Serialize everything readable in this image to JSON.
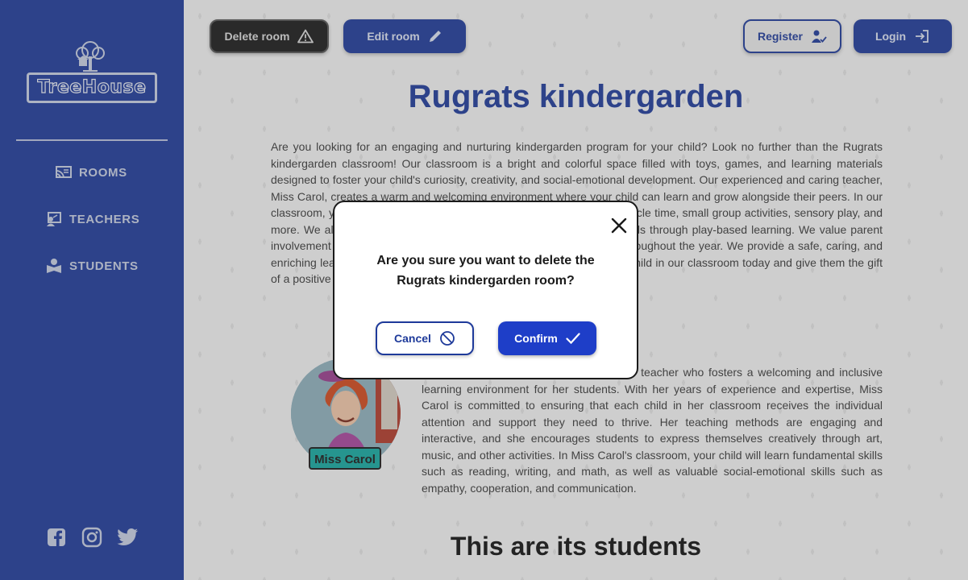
{
  "brand": {
    "name": "TreeHouse"
  },
  "sidebar": {
    "items": [
      {
        "label": "ROOMS",
        "icon": "rooms-icon"
      },
      {
        "label": "TEACHERS",
        "icon": "teachers-icon"
      },
      {
        "label": "STUDENTS",
        "icon": "students-icon"
      }
    ],
    "social": [
      "facebook-icon",
      "instagram-icon",
      "twitter-icon"
    ]
  },
  "toolbar": {
    "delete_label": "Delete room",
    "edit_label": "Edit room",
    "register_label": "Register",
    "login_label": "Login"
  },
  "room": {
    "title": "Rugrats kindergarden",
    "description": "Are you looking for an engaging and nurturing kindergarden program for your child? Look no further than the Rugrats kindergarden classroom! Our classroom is a bright and colorful space filled with toys, games, and learning materials designed to foster your child's curiosity, creativity, and social-emotional development. Our experienced and caring teacher, Miss Carol, creates a warm and welcoming environment where your child can learn and grow alongside their peers. In our classroom, your child will participate in a variety of activities, including circle time, small group activities, sensory play, and more. We also focus on early literacy, math and science, and social skills through play-based learning. We value parent involvement and strive to maintain open communication with families throughout the year. We provide a safe, caring, and enriching learning environment where your child can thrive. Enroll your child in our classroom today and give them the gift of a positive and meaningful educational experience."
  },
  "teacher": {
    "name": "Miss Carol",
    "bio": "Miss Carol is a dedicated and passionate teacher who fosters a welcoming and inclusive learning environment for her students. With her years of experience and expertise, Miss Carol is committed to ensuring that each child in her classroom receives the individual attention and support they need to thrive. Her teaching methods are engaging and interactive, and she encourages students to express themselves creatively through art, music, and other activities. In Miss Carol's classroom, your child will learn fundamental skills such as reading, writing, and math, as well as valuable social-emotional skills such as empathy, cooperation, and communication."
  },
  "students_section": {
    "title": "This are its students"
  },
  "modal": {
    "message_line1": "Are you sure you want to delete the",
    "message_line2": "Rugrats kindergarden room?",
    "cancel_label": "Cancel",
    "confirm_label": "Confirm"
  },
  "colors": {
    "sidebar": "#1e3a9a",
    "accent": "#1e3ec8",
    "teacher_tag": "#14a8a0"
  }
}
